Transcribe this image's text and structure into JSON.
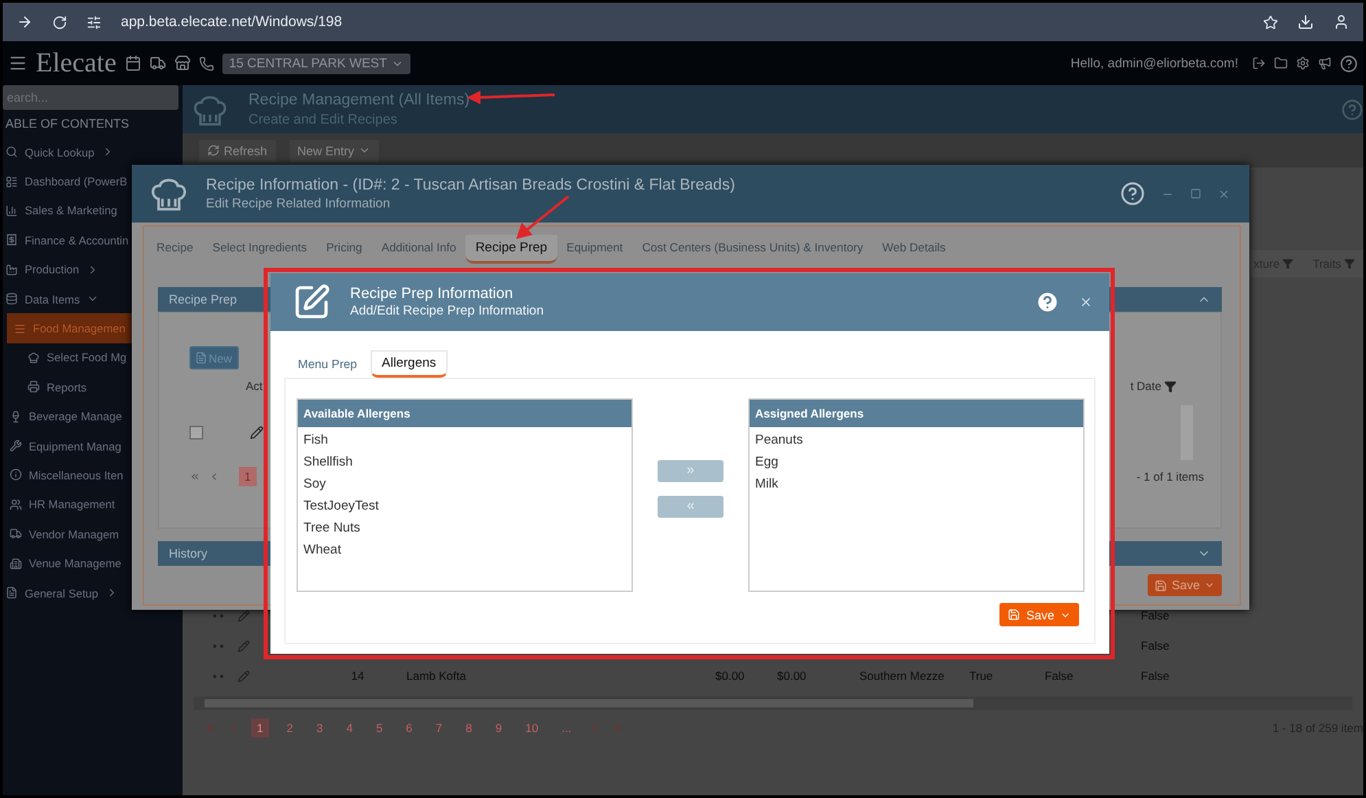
{
  "browser": {
    "url": "app.beta.elecate.net/Windows/198"
  },
  "app_header": {
    "logo": "Elecate",
    "location": "15 CENTRAL PARK WEST",
    "greeting": "Hello, admin@eliorbeta.com!"
  },
  "sidebar": {
    "search": {
      "placeholder": "earch..."
    },
    "heading": "ABLE OF CONTENTS",
    "items": [
      {
        "label": "Quick Lookup",
        "expanded": false,
        "selected": false
      },
      {
        "label": "Dashboard (PowerB",
        "selected": false
      },
      {
        "label": "Sales & Marketing",
        "selected": false
      },
      {
        "label": "Finance & Accountin",
        "selected": false
      },
      {
        "label": "Production",
        "expanded": false,
        "selected": false
      },
      {
        "label": "Data Items",
        "expanded": true,
        "selected": false,
        "children": [
          {
            "label": "Food Managemen",
            "selected": true,
            "children": [
              {
                "label": "Select Food Mg",
                "selected": false
              },
              {
                "label": "Reports",
                "selected": false
              }
            ]
          },
          {
            "label": "Beverage Manage",
            "selected": false
          },
          {
            "label": "Equipment Manag",
            "selected": false
          },
          {
            "label": "Miscellaneous Iten",
            "selected": false
          },
          {
            "label": "HR Management",
            "selected": false
          },
          {
            "label": "Vendor Managem",
            "selected": false
          },
          {
            "label": "Venue Manageme",
            "selected": false
          }
        ]
      },
      {
        "label": "General Setup",
        "expanded": false,
        "selected": false
      }
    ]
  },
  "main": {
    "title": "Recipe Management (All Items)",
    "subtitle": "Create and Edit Recipes",
    "toolbar": [
      {
        "label": "Refresh",
        "kind": "refresh"
      },
      {
        "label": "New Entry",
        "kind": "dropdown"
      }
    ],
    "table": {
      "columns": [
        {
          "label": "xture"
        },
        {
          "label": "Traits"
        }
      ],
      "rows": [
        {
          "column_8": "False"
        },
        {
          "column_8": "False"
        },
        {
          "number": "14",
          "name": "Lamb Kofta",
          "column_3": "$0.00",
          "column_4": "$0.00",
          "column_5": "Southern Mezze",
          "column_6": "True",
          "column_7": "False",
          "column_8": "False"
        }
      ],
      "pages": [
        {
          "label": "1",
          "selected": true
        },
        {
          "label": "2",
          "selected": false
        },
        {
          "label": "3",
          "selected": false
        },
        {
          "label": "4",
          "selected": false
        },
        {
          "label": "5",
          "selected": false
        },
        {
          "label": "6",
          "selected": false
        },
        {
          "label": "7",
          "selected": false
        },
        {
          "label": "8",
          "selected": false
        },
        {
          "label": "9",
          "selected": false
        },
        {
          "label": "10",
          "selected": false
        },
        {
          "label": "...",
          "selected": false
        }
      ],
      "summary": "1 - 18 of 259 item"
    }
  },
  "recipe_dialog": {
    "title": "Recipe Information - (ID#: 2 - Tuscan Artisan Breads Crostini & Flat Breads)",
    "subtitle": "Edit Recipe Related Information",
    "tabs": [
      {
        "label": "Recipe",
        "selected": false
      },
      {
        "label": "Select Ingredients",
        "selected": false
      },
      {
        "label": "Pricing",
        "selected": false
      },
      {
        "label": "Additional Info",
        "selected": false
      },
      {
        "label": "Recipe Prep",
        "selected": true
      },
      {
        "label": "Equipment",
        "selected": false
      },
      {
        "label": "Cost Centers (Business Units) & Inventory",
        "selected": false
      },
      {
        "label": "Web Details",
        "selected": false
      }
    ],
    "panel": {
      "title": "Recipe Prep",
      "new_button": "New",
      "row_checked": false,
      "column_1": "Act",
      "column_2": "t Date",
      "page": "1",
      "summary": "- 1 of 1 items"
    },
    "history": "History",
    "save": "Save"
  },
  "prep_modal": {
    "title": "Recipe Prep Information",
    "subtitle": "Add/Edit Recipe Prep Information",
    "tabs": [
      {
        "label": "Menu Prep",
        "selected": false
      },
      {
        "label": "Allergens",
        "selected": true
      }
    ],
    "available": {
      "title": "Available Allergens",
      "items": [
        "Fish",
        "Shellfish",
        "Soy",
        "TestJoeyTest",
        "Tree Nuts",
        "Wheat"
      ]
    },
    "assigned": {
      "title": "Assigned Allergens",
      "items": [
        "Peanuts",
        "Egg",
        "Milk"
      ]
    },
    "move_right": "»",
    "move_left": "«",
    "save": "Save"
  }
}
